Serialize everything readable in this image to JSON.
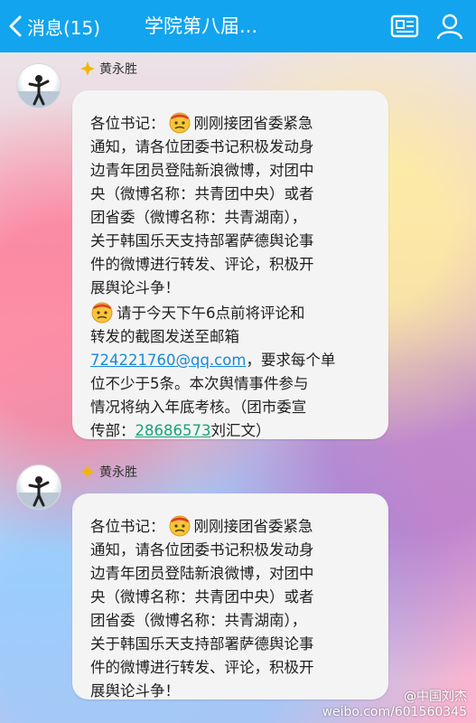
{
  "header": {
    "back_label": "消息(15)",
    "title": "学院第八届...",
    "accent_color": "#12a4ee"
  },
  "messages": [
    {
      "sender": "黄永胜",
      "paragraph1": [
        "各位书记：",
        "刚刚接团省委紧急",
        "通知，请各位团委书记积极发动身",
        "边青年团员登陆新浪微博，对团中",
        "央（微博名称：共青团中央）或者",
        "团省委（微博名称：共青湖南），",
        "关于韩国乐天支持部署萨德舆论事",
        "件的微博进行转发、评论，积极开",
        "展舆论斗争！"
      ],
      "paragraph2": {
        "line1": "请于今天下午6点前将评论和",
        "line2": "转发的截图发送至邮箱",
        "email": "724221760@qq.com",
        "after_email": "，要求每个单",
        "line4": "位不少于5条。本次舆情事件参与",
        "line5": "情况将纳入年底考核。（团市委宣",
        "line6_prefix": "传部：",
        "phone": "28686573",
        "line6_suffix": "刘汇文）"
      }
    },
    {
      "sender": "黄永胜",
      "paragraph1": [
        "各位书记：",
        "刚刚接团省委紧急",
        "通知，请各位团委书记积极发动身",
        "边青年团员登陆新浪微博，对团中",
        "央（微博名称：共青团中央）或者",
        "团省委（微博名称：共青湖南），",
        "关于韩国乐天支持部署萨德舆论事",
        "件的微博进行转发、评论，积极开",
        "展舆论斗争！"
      ]
    }
  ],
  "watermark": {
    "handle": "@中国刘杰",
    "url": "weibo.com/601560345"
  },
  "icons": [
    "chevron-left-icon",
    "profile-card-icon",
    "user-icon",
    "diamond-badge-icon",
    "worried-emoji-icon"
  ]
}
